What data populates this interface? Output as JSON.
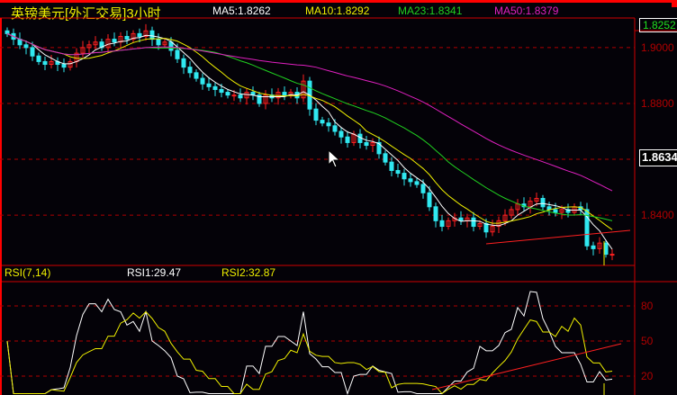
{
  "header": {
    "title": "英镑美元[外汇交易]3小时",
    "ma5": "MA5:1.8262",
    "ma10": "MA10:1.8292",
    "ma23": "MA23:1.8341",
    "ma50": "MA50:1.8379"
  },
  "price_axis": {
    "top_label": "1.8252",
    "cursor_label": "1.8634",
    "ticks": [
      "1.9000",
      "1.8800",
      "1.8400"
    ]
  },
  "rsi": {
    "title": "RSI(7,14)",
    "rsi1": "RSI1:29.47",
    "rsi2": "RSI2:32.87",
    "ticks": [
      "80",
      "50",
      "20"
    ]
  },
  "colors": {
    "up": "#ff2020",
    "down": "#30e8f0",
    "ma5": "#ffffff",
    "ma10": "#f0f000",
    "ma23": "#20d020",
    "ma50": "#e020c0",
    "grid": "#b00000"
  },
  "chart_data": {
    "type": "candlestick",
    "title": "英镑美元[外汇交易]3小时",
    "ylim": [
      1.822,
      1.9106
    ],
    "rsi_ylim": [
      0,
      100
    ],
    "closes": [
      1.905,
      1.903,
      1.901,
      1.9,
      1.897,
      1.895,
      1.894,
      1.895,
      1.894,
      1.893,
      1.895,
      1.898,
      1.9,
      1.901,
      1.902,
      1.9,
      1.903,
      1.902,
      1.904,
      1.903,
      1.905,
      1.904,
      1.906,
      1.903,
      1.901,
      1.902,
      1.899,
      1.896,
      1.893,
      1.891,
      1.889,
      1.887,
      1.886,
      1.885,
      1.884,
      1.883,
      1.883,
      1.882,
      1.884,
      1.883,
      1.88,
      1.883,
      1.882,
      1.884,
      1.883,
      1.884,
      1.882,
      1.888,
      1.878,
      1.874,
      1.873,
      1.872,
      1.87,
      1.868,
      1.866,
      1.869,
      1.866,
      1.865,
      1.866,
      1.862,
      1.859,
      1.856,
      1.855,
      1.853,
      1.852,
      1.851,
      1.848,
      1.843,
      1.838,
      1.836,
      1.838,
      1.839,
      1.838,
      1.839,
      1.836,
      1.837,
      1.834,
      1.836,
      1.838,
      1.84,
      1.842,
      1.844,
      1.843,
      1.845,
      1.846,
      1.843,
      1.842,
      1.841,
      1.842,
      1.841,
      1.843,
      1.842,
      1.829,
      1.828,
      1.83,
      1.826,
      1.826
    ],
    "moving_averages": [
      5,
      10,
      23,
      50
    ],
    "rsi_periods": [
      7,
      14
    ],
    "rsi_levels": [
      80,
      50,
      20
    ]
  }
}
